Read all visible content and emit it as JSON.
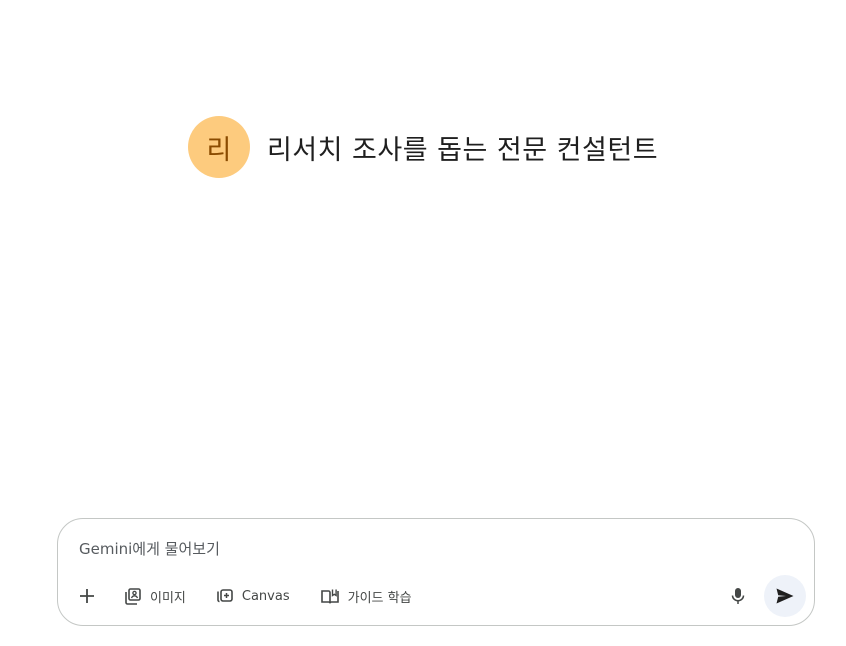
{
  "header": {
    "avatar_letter": "리",
    "title": "리서치 조사를 돕는 전문 컨설턴트"
  },
  "composer": {
    "placeholder": "Gemini에게 물어보기",
    "tools": [
      {
        "label": "이미지",
        "icon": "image-icon"
      },
      {
        "label": "Canvas",
        "icon": "canvas-icon"
      },
      {
        "label": "가이드 학습",
        "icon": "book-icon"
      }
    ]
  },
  "colors": {
    "avatar_bg": "#fdcb7e",
    "avatar_text": "#8a4b00",
    "send_bg": "#eef2f9"
  }
}
